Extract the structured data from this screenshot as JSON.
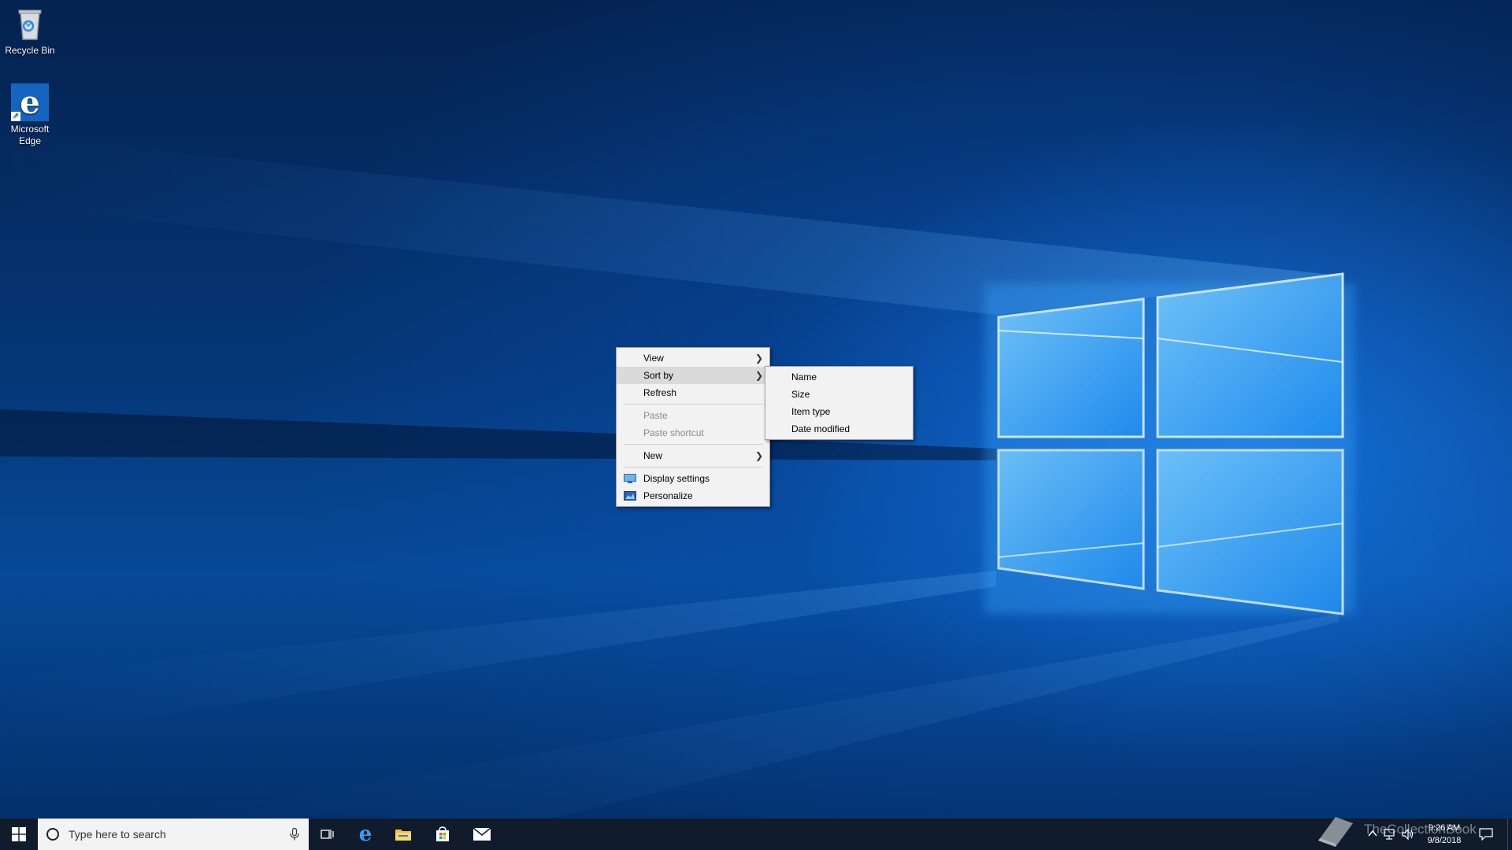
{
  "desktop": {
    "icons": [
      {
        "label": "Recycle Bin",
        "icon": "recycle-bin-icon"
      },
      {
        "label": "Microsoft Edge",
        "icon": "edge-icon"
      }
    ]
  },
  "context_menu": {
    "items": [
      {
        "label": "View",
        "has_submenu": true
      },
      {
        "label": "Sort by",
        "has_submenu": true,
        "highlighted": true
      },
      {
        "label": "Refresh"
      },
      {
        "label": "Paste",
        "disabled": true
      },
      {
        "label": "Paste shortcut",
        "disabled": true
      },
      {
        "label": "New",
        "has_submenu": true
      },
      {
        "label": "Display settings",
        "icon": "display-settings-icon"
      },
      {
        "label": "Personalize",
        "icon": "personalize-icon"
      }
    ]
  },
  "sortby_submenu": {
    "items": [
      {
        "label": "Name"
      },
      {
        "label": "Size"
      },
      {
        "label": "Item type"
      },
      {
        "label": "Date modified"
      }
    ]
  },
  "taskbar": {
    "search_placeholder": "Type here to search",
    "pinned": [
      "task-view-icon",
      "edge-icon",
      "file-explorer-icon",
      "store-icon",
      "mail-icon"
    ],
    "clock": {
      "time": "9:26 AM",
      "date": "9/8/2018"
    }
  },
  "watermark": {
    "text": "TheCollectionBook"
  },
  "colors": {
    "taskbar": "#101c2c",
    "menu_bg": "#f2f2f2",
    "menu_highlight": "#dadada",
    "accent": "#1565c0"
  }
}
